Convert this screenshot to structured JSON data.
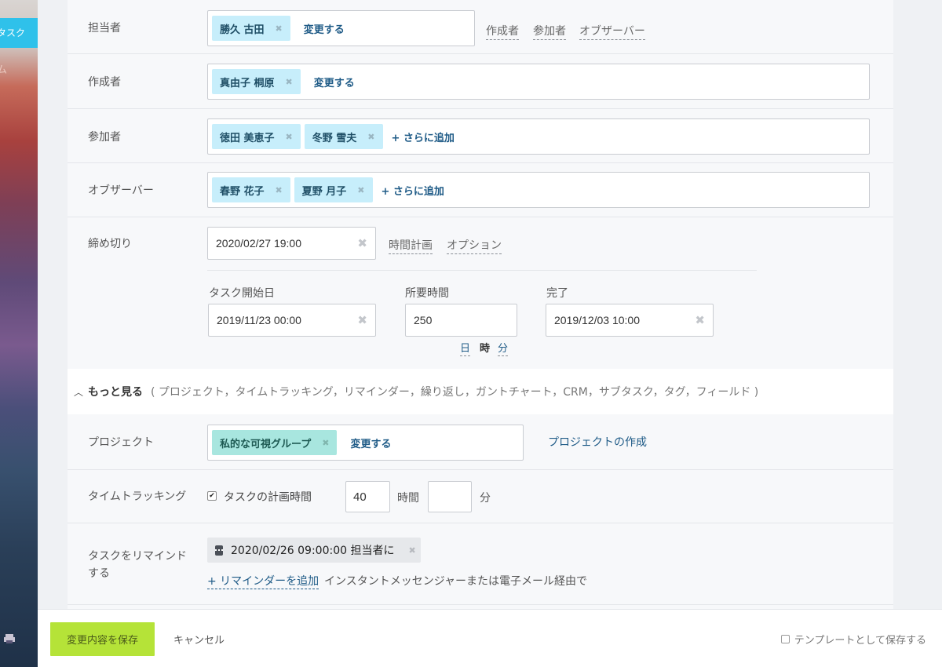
{
  "sidebar": {
    "active_item": "タスク",
    "second_item": "ム"
  },
  "fields": {
    "assignee": {
      "label": "担当者",
      "chips": [
        "勝久 古田"
      ],
      "change_label": "変更する",
      "quick_links": [
        "作成者",
        "参加者",
        "オブザーバー"
      ]
    },
    "creator": {
      "label": "作成者",
      "chips": [
        "真由子 桐原"
      ],
      "change_label": "変更する"
    },
    "participants": {
      "label": "参加者",
      "chips": [
        "徳田 美恵子",
        "冬野 雪夫"
      ],
      "add_label": "+ さらに追加"
    },
    "observers": {
      "label": "オブザーバー",
      "chips": [
        "春野 花子",
        "夏野 月子"
      ],
      "add_label": "+ さらに追加"
    },
    "deadline": {
      "label": "締め切り",
      "value": "2020/02/27 19:00",
      "links": [
        "時間計画",
        "オプション"
      ],
      "start_label": "タスク開始日",
      "start_value": "2019/11/23 00:00",
      "duration_label": "所要時間",
      "duration_value": "250",
      "units": [
        "日",
        "時",
        "分"
      ],
      "active_unit": "時",
      "end_label": "完了",
      "end_value": "2019/12/03 10:00"
    }
  },
  "more": {
    "title": "もっと見る",
    "description": "( プロジェクト，タイムトラッキング，リマインダー，繰り返し，ガントチャート，CRM，サブタスク，タグ，フィールド )"
  },
  "project": {
    "label": "プロジェクト",
    "chip": "私的な可視グループ",
    "change_label": "変更する",
    "create_link": "プロジェクトの作成"
  },
  "time_tracking": {
    "label": "タイムトラッキング",
    "checkbox_label": "タスクの計画時間",
    "checked": true,
    "hours_value": "40",
    "hours_unit": "時間",
    "minutes_value": "",
    "minutes_unit": "分"
  },
  "reminder": {
    "label_line1": "タスクをリマインド",
    "label_line2": "する",
    "chip_text": "2020/02/26 09:00:00 担当者に",
    "add_link": "+ リマインダーを追加",
    "add_suffix": "インスタントメッセンジャーまたは電子メール経由で"
  },
  "footer": {
    "save_label": "変更内容を保存",
    "cancel_label": "キャンセル",
    "template_label": "テンプレートとして保存する"
  },
  "colors": {
    "chip_blue": "#c7eefb",
    "chip_teal": "#a8e6df",
    "save_green": "#b5e338",
    "sidebar_active": "#2fc1ea",
    "link_blue": "#1f5b87"
  }
}
